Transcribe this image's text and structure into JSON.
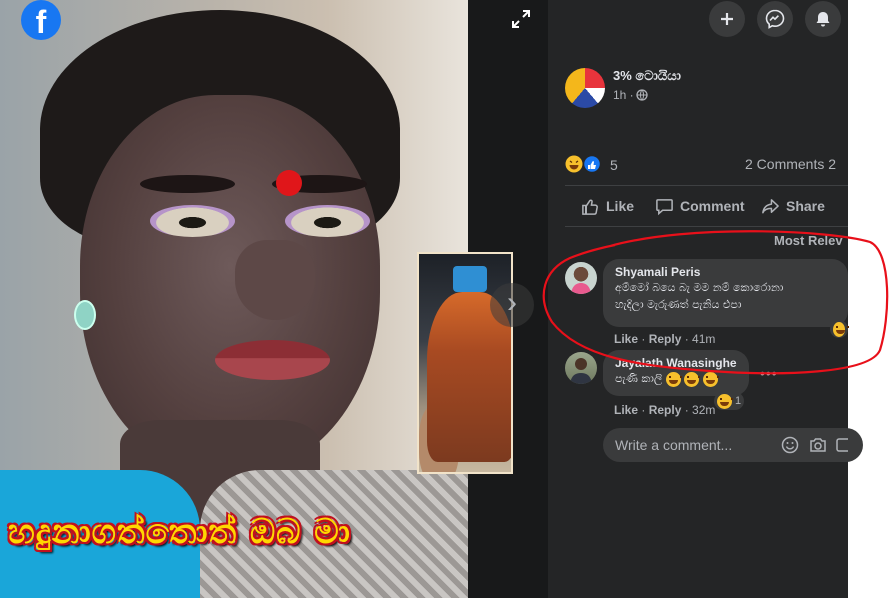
{
  "photo": {
    "caption": "හදුනාගත්තොත් ඔබ මා",
    "logo_letter": "f",
    "next_glyph": "›"
  },
  "post": {
    "page_name": "3% ටොයියා",
    "time": "1h ·",
    "reactions_count": "5",
    "comments_count": "2 Comments  2"
  },
  "actions": {
    "like": "Like",
    "comment": "Comment",
    "share": "Share"
  },
  "sort_label": "Most Relev",
  "comments": [
    {
      "author": "Shyamali Peris",
      "line1": "අම්මෝ බයෙ බැ මම නම් කොරොනා",
      "line2": "හැදිලා මැරුණත් පැනිය එපා",
      "like": "Like",
      "reply": "Reply",
      "time": "41m",
      "sep": " · "
    },
    {
      "author": "Jayalath Wanasinghe",
      "line1": "පැණි කාලි",
      "like": "Like",
      "reply": "Reply",
      "time": "32m",
      "sep": " · ",
      "reaction_count": "1"
    }
  ],
  "write_comment": {
    "placeholder": "Write a comment..."
  },
  "colors": {
    "panel": "#242526",
    "viewer": "#18191a",
    "bubble": "#3a3b3c",
    "annotation": "#e8101a",
    "brand": "#1877f2"
  },
  "icons": [
    "facebook-logo-icon",
    "expand-icon",
    "plus-icon",
    "messenger-icon",
    "bell-icon",
    "globe-icon",
    "like-icon",
    "comment-icon",
    "share-icon",
    "emoji-icon",
    "camera-icon",
    "gif-icon"
  ]
}
